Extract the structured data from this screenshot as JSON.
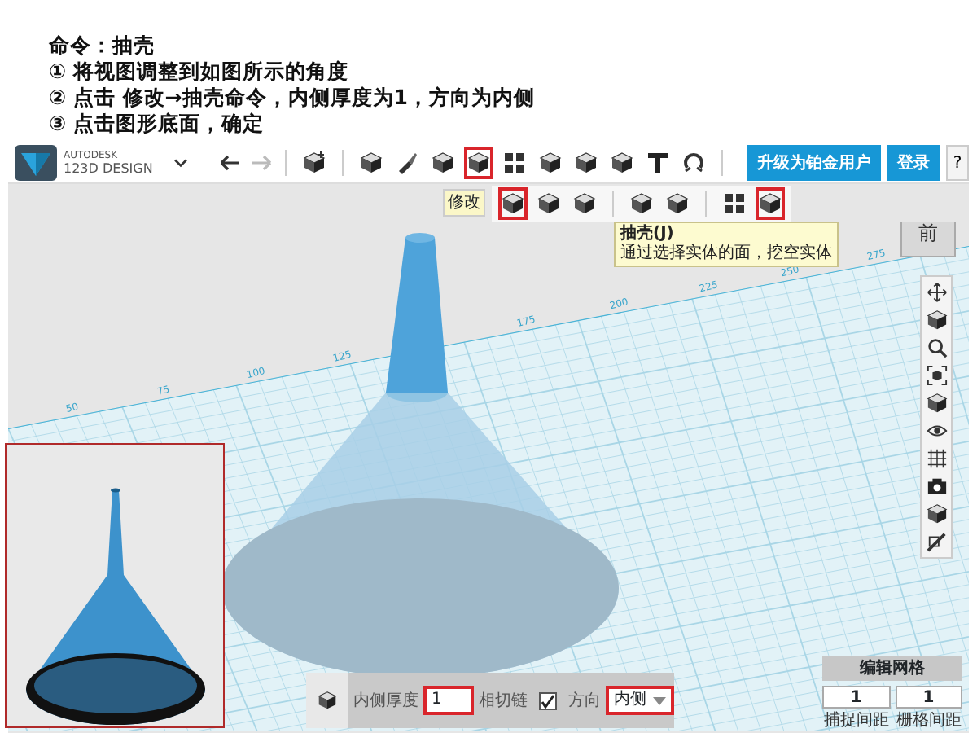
{
  "instructions": {
    "title": "命令：抽壳",
    "steps": [
      "① 将视图调整到如图所示的角度",
      "② 点击  修改→抽壳命令，内侧厚度为1，方向为内侧",
      "③ 点击图形底面，确定"
    ]
  },
  "app": {
    "logo": {
      "brand": "AUTODESK",
      "product": "123D DESIGN"
    },
    "main_tools": [
      {
        "highlighted": false
      },
      {
        "highlighted": false
      },
      {
        "highlighted": false
      },
      {
        "highlighted": true
      },
      {
        "highlighted": false
      },
      {
        "highlighted": false
      },
      {
        "highlighted": false
      },
      {
        "highlighted": false
      },
      {
        "highlighted": false
      },
      {
        "highlighted": false
      }
    ],
    "upgrade_button": "升级为铂金用户",
    "login_button": "登录",
    "help_button": "?",
    "modify_label": "修改",
    "modify_tools": [
      {
        "highlighted": true
      },
      {
        "highlighted": false
      },
      {
        "highlighted": false
      },
      {
        "highlighted": false
      },
      {
        "highlighted": false
      },
      {
        "highlighted": false
      },
      {
        "highlighted": true
      }
    ],
    "tooltip": {
      "title": "抽壳(J)",
      "text": "通过选择实体的面，挖空实体"
    },
    "view_cube": "前",
    "grid_labels": [
      "50",
      "75",
      "100",
      "125",
      "175",
      "200",
      "225",
      "250",
      "275"
    ],
    "shell_panel": {
      "thickness_label": "内侧厚度",
      "thickness": "1",
      "thickness_highlighted": true,
      "tangent_label": "相切链",
      "tangent_checked": true,
      "direction_label": "方向",
      "direction": "内侧",
      "direction_highlighted": true
    },
    "edit_grid": {
      "title": "编辑网格",
      "fields": [
        {
          "value": "1",
          "label": "捕捉间距"
        },
        {
          "value": "1",
          "label": "栅格间距"
        }
      ]
    }
  }
}
